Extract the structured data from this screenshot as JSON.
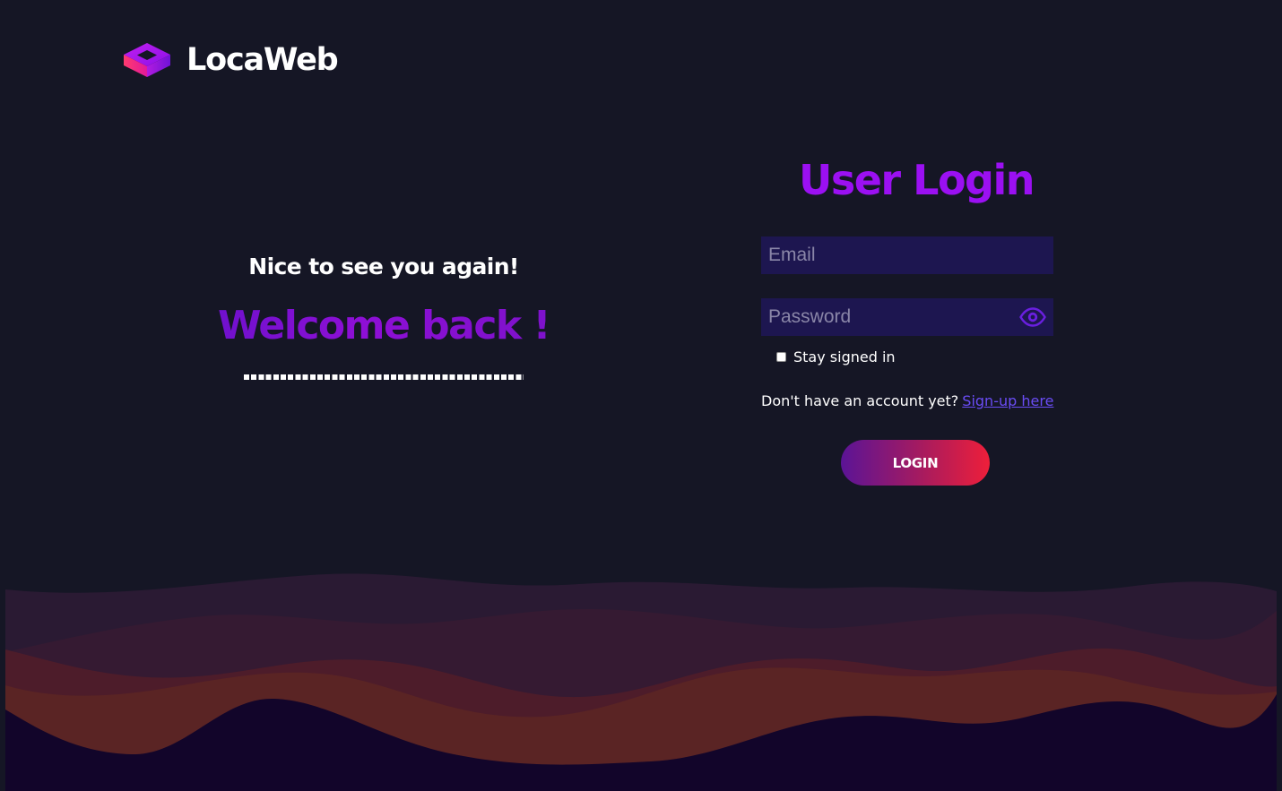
{
  "brand": {
    "name": "LocaWeb",
    "logo_icon": "cube-logo-icon"
  },
  "welcome": {
    "greeting": "Nice to see you again!",
    "headline": "Welcome back !"
  },
  "login": {
    "title": "User Login",
    "email_placeholder": "Email",
    "password_placeholder": "Password",
    "password_toggle_icon": "eye-icon",
    "remember_label": "Stay signed in",
    "signup_prompt": "Don't have an account yet?",
    "signup_link": "Sign-up here",
    "submit_label": "LOGIN"
  },
  "colors": {
    "background": "#151625",
    "accent": "#9b10f2",
    "input_bg": "#1d1650",
    "link": "#6a4cf5",
    "button_gradient_start": "#5b1496",
    "button_gradient_end": "#ee1f3a"
  }
}
